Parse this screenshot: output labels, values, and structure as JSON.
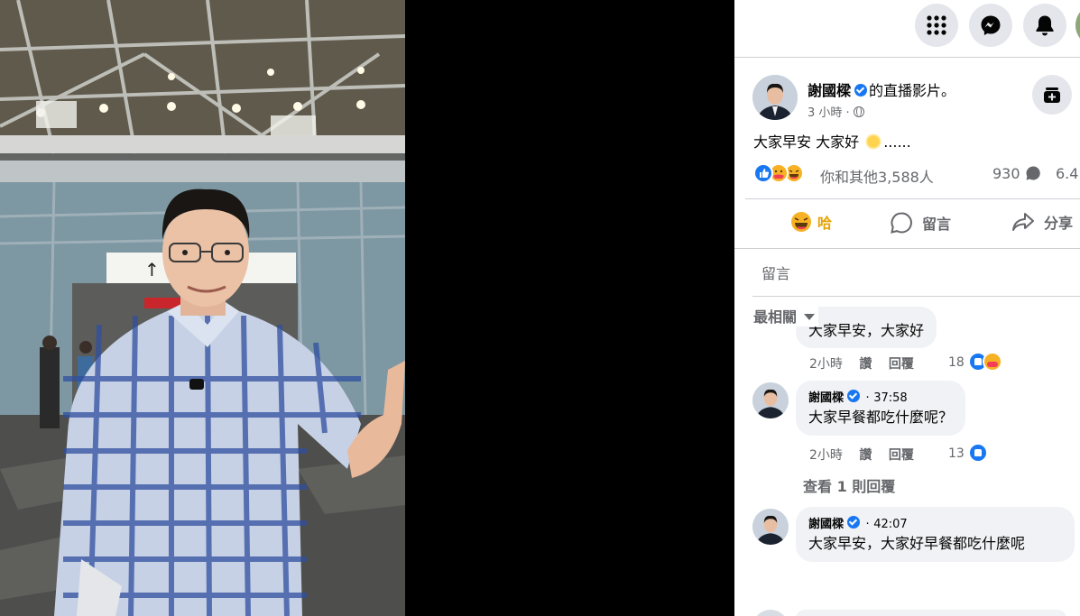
{
  "topbar": {
    "menu_icon": "grid-menu-icon",
    "messenger_icon": "messenger-icon",
    "notifications_icon": "bell-icon"
  },
  "post": {
    "author": "謝國樑",
    "suffix": "的直播影片。",
    "time": "3 小時 ·",
    "privacy_icon": "globe-icon",
    "text": "大家早安 大家好",
    "text_tail": "......",
    "reaction_summary": "你和其他3,588人",
    "comment_count": "930",
    "share_count": "6.4"
  },
  "actions": {
    "reaction_label": "哈",
    "comment_label": "留言",
    "share_label": "分享"
  },
  "comments_section": {
    "tab_label": "留言",
    "sort_label": "最相關"
  },
  "comments": [
    {
      "text": "大家早安，大家好",
      "age": "2小時",
      "like_label": "讚",
      "reply_label": "回覆",
      "reaction_count": "18"
    },
    {
      "author": "謝國樑",
      "timestamp": "37:58",
      "separator": "·",
      "text": "大家早餐都吃什麼呢？",
      "age": "2小時",
      "like_label": "讚",
      "reply_label": "回覆",
      "reaction_count": "13",
      "view_replies": "查看 1 則回覆"
    },
    {
      "author": "謝國樑",
      "timestamp": "42:07",
      "separator": "·",
      "text": "大家早安，大家好早餐都吃什麼呢"
    }
  ],
  "colors": {
    "facebook_blue": "#1877f2",
    "panel_bg": "#ffffff",
    "bubble_bg": "#f0f2f5",
    "secondary_text": "#65676b"
  }
}
